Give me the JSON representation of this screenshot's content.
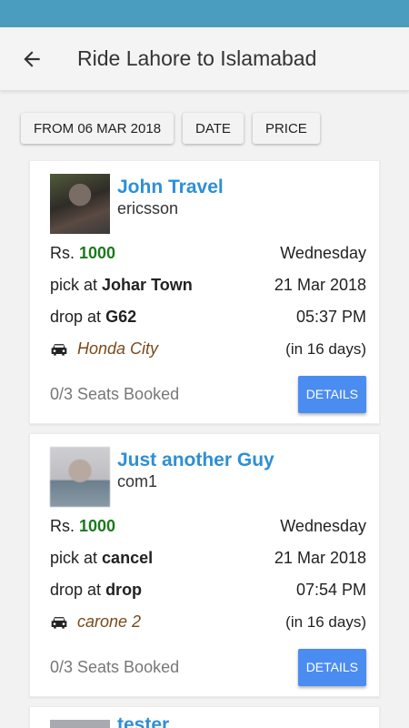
{
  "appbar": {
    "title": "Ride Lahore to Islamabad"
  },
  "filters": [
    "FROM 06 MAR 2018",
    "DATE",
    "PRICE"
  ],
  "rides": [
    {
      "driver_name": "John Travel",
      "username": "ericsson",
      "price_prefix": "Rs.",
      "price": "1000",
      "day": "Wednesday",
      "pick_prefix": "pick at",
      "pick": "Johar Town",
      "date": "21 Mar 2018",
      "drop_prefix": "drop at",
      "drop": "G62",
      "time": "05:37 PM",
      "car_icon": "car-icon",
      "car": "Honda City",
      "relative": "(in 16 days)",
      "seats": "0/3 Seats Booked",
      "details_label": "DETAILS"
    },
    {
      "driver_name": "Just another Guy",
      "username": "com1",
      "price_prefix": "Rs.",
      "price": "1000",
      "day": "Wednesday",
      "pick_prefix": "pick at",
      "pick": "cancel",
      "date": "21 Mar 2018",
      "drop_prefix": "drop at",
      "drop": "drop",
      "time": "07:54 PM",
      "car_icon": "car-icon",
      "car": "carone 2",
      "relative": "(in 16 days)",
      "seats": "0/3 Seats Booked",
      "details_label": "DETAILS"
    },
    {
      "driver_name": "tester"
    }
  ],
  "colors": {
    "status_bar": "#4a9dbf",
    "name": "#2e8fd6",
    "price": "#1b7a1b",
    "button": "#4b8cf0",
    "car_name": "#7a4a1a"
  }
}
